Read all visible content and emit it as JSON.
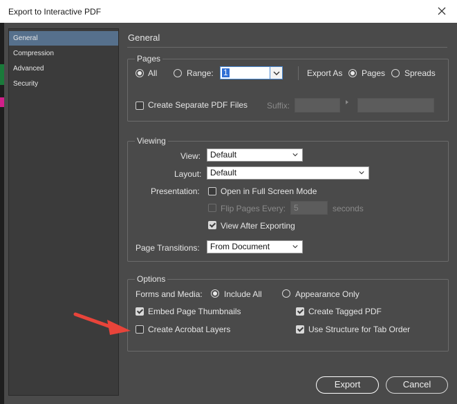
{
  "window": {
    "title": "Export to Interactive PDF",
    "close_icon": "close-icon"
  },
  "sidebar": {
    "items": [
      {
        "label": "General",
        "active": true
      },
      {
        "label": "Compression",
        "active": false
      },
      {
        "label": "Advanced",
        "active": false
      },
      {
        "label": "Security",
        "active": false
      }
    ]
  },
  "main": {
    "title": "General"
  },
  "pages": {
    "legend": "Pages",
    "all_label": "All",
    "range_label": "Range:",
    "range_value": "1",
    "export_as_label": "Export As",
    "pages_label": "Pages",
    "spreads_label": "Spreads",
    "separate_files_label": "Create Separate PDF Files",
    "suffix_label": "Suffix:",
    "selected_scope": "All",
    "selected_export_as": "Pages"
  },
  "viewing": {
    "legend": "Viewing",
    "view_label": "View:",
    "view_value": "Default",
    "layout_label": "Layout:",
    "layout_value": "Default",
    "presentation_label": "Presentation:",
    "full_screen_label": "Open in Full Screen Mode",
    "flip_pages_label": "Flip Pages Every:",
    "flip_value": "5",
    "seconds_label": "seconds",
    "view_after_label": "View After Exporting",
    "transitions_label": "Page Transitions:",
    "transitions_value": "From Document"
  },
  "options": {
    "legend": "Options",
    "forms_label": "Forms and Media:",
    "include_all_label": "Include All",
    "appearance_only_label": "Appearance Only",
    "embed_thumbnails_label": "Embed Page Thumbnails",
    "create_tagged_label": "Create Tagged PDF",
    "acrobat_layers_label": "Create Acrobat Layers",
    "structure_tab_label": "Use Structure for Tab Order",
    "selected_forms": "Include All"
  },
  "buttons": {
    "export_label": "Export",
    "cancel_label": "Cancel"
  },
  "colors": {
    "accent": "#56708c",
    "annotation_arrow": "#e8443a"
  }
}
